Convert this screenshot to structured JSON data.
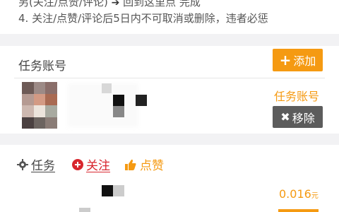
{
  "notice": {
    "line1_partial": "另(关注/点赞/评论)",
    "line1_tail": "回到这里点 完成",
    "line2": "4. 关注/点赞/评论后5日内不可取消或删除，违者必惩"
  },
  "account_section": {
    "title": "任务账号",
    "add_label": "添加",
    "account_link": "任务账号",
    "remove_label": "移除"
  },
  "task_section": {
    "tabs": [
      {
        "label": "任务",
        "icon": "gear-icon"
      },
      {
        "label": "关注",
        "icon": "plus-circle-icon"
      },
      {
        "label": "点赞",
        "icon": "thumbs-up-icon"
      }
    ],
    "price_value": "0.016",
    "price_unit": "元"
  },
  "colors": {
    "accent": "#f59a12",
    "danger": "#d8262e",
    "dark_button": "#5c5c5c",
    "background": "#f2f2f4"
  }
}
